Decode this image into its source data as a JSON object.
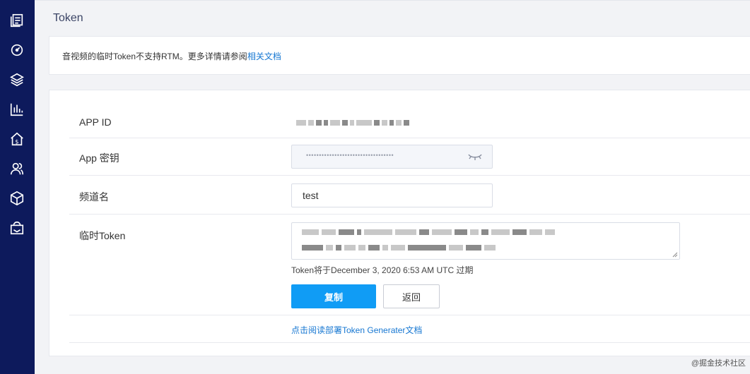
{
  "sidebar": {
    "items": [
      {
        "icon": "document-list-icon"
      },
      {
        "icon": "gauge-icon"
      },
      {
        "icon": "layers-icon"
      },
      {
        "icon": "bar-chart-icon"
      },
      {
        "icon": "billing-home-icon"
      },
      {
        "icon": "users-icon"
      },
      {
        "icon": "cube-icon"
      },
      {
        "icon": "support-icon"
      }
    ]
  },
  "page": {
    "title": "Token"
  },
  "notice": {
    "text": "音视频的临时Token不支持RTM。更多详情请参阅",
    "link": "相关文档"
  },
  "form": {
    "app_id_label": "APP ID",
    "app_secret_label": "App 密钥",
    "app_secret_mask": "••••••••••••••••••••••••••••••••••",
    "channel_label": "频道名",
    "channel_value": "test",
    "token_label": "临时Token",
    "expire_text": "Token将于December 3, 2020 6:53 AM UTC 过期",
    "copy_button": "复制",
    "back_button": "返回",
    "doc_link": "点击阅读部署Token Generater文档"
  },
  "watermark": "@掘金技术社区",
  "colors": {
    "sidebar_bg": "#0d1a5c",
    "primary": "#109cf5",
    "link": "#1677d2"
  }
}
